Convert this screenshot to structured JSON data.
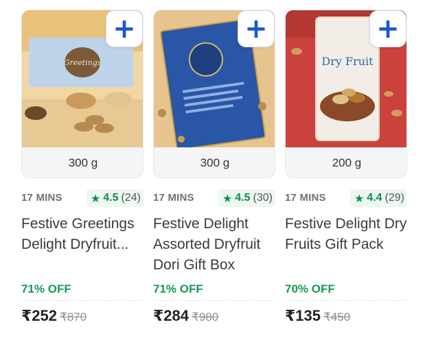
{
  "products": [
    {
      "weight": "300 g",
      "eta": "17 MINS",
      "rating": "4.5",
      "rating_count": "(24)",
      "title": "Festive Greetings Delight Dryfruit...",
      "discount": "71% OFF",
      "price": "₹252",
      "mrp": "₹870",
      "image_caption": "Greetings"
    },
    {
      "weight": "300 g",
      "eta": "17 MINS",
      "rating": "4.5",
      "rating_count": "(30)",
      "title": "Festive Delight Assorted Dryfruit Dori Gift Box",
      "discount": "71% OFF",
      "price": "₹284",
      "mrp": "₹980",
      "image_caption": ""
    },
    {
      "weight": "200 g",
      "eta": "17 MINS",
      "rating": "4.4",
      "rating_count": "(29)",
      "title": "Festive Delight Dry Fruits Gift Pack",
      "discount": "70% OFF",
      "price": "₹135",
      "mrp": "₹450",
      "image_caption": "Dry Fruit"
    }
  ],
  "colors": {
    "accent": "#1a56db",
    "discount": "#159a55",
    "rating": "#108a4d"
  },
  "icons": {
    "add": "plus-icon",
    "rating": "star-icon"
  }
}
